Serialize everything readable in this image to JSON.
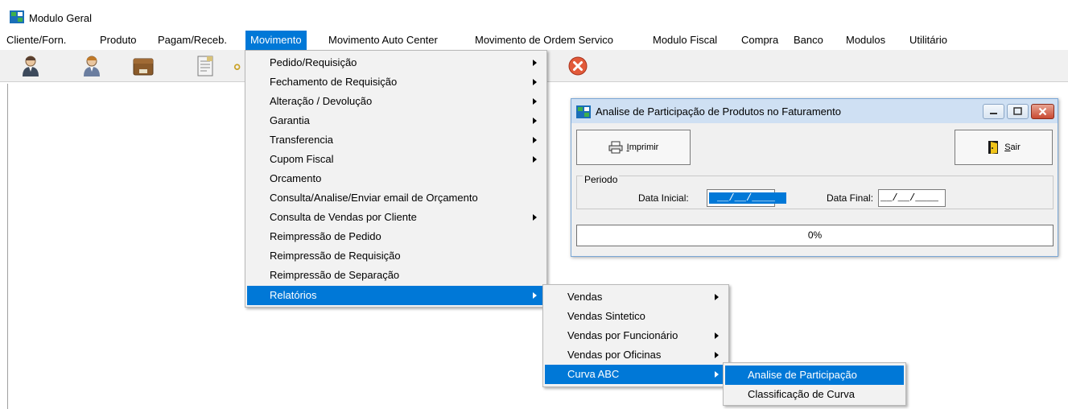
{
  "app": {
    "title": "Modulo Geral"
  },
  "menubar": {
    "items": [
      {
        "label": "Cliente/Forn.",
        "active": false
      },
      {
        "label": "Produto",
        "active": false
      },
      {
        "label": "Pagam/Receb.",
        "active": false
      },
      {
        "label": "Movimento",
        "active": true
      },
      {
        "label": "Movimento Auto Center",
        "active": false
      },
      {
        "label": "Movimento de Ordem Servico",
        "active": false
      },
      {
        "label": "Modulo Fiscal",
        "active": false
      },
      {
        "label": "Compra",
        "active": false
      },
      {
        "label": "Banco",
        "active": false
      },
      {
        "label": "Modulos",
        "active": false
      },
      {
        "label": "Utilitário",
        "active": false
      }
    ]
  },
  "toolbar": {
    "buttons": [
      "client-icon",
      "supplier-icon",
      "product-box-icon",
      "document-icon",
      "key-icon",
      "close-circle-icon"
    ]
  },
  "movimento_menu": {
    "items": [
      {
        "label": "Pedido/Requisição",
        "submenu": true
      },
      {
        "label": "Fechamento  de Requisição",
        "submenu": true
      },
      {
        "label": "Alteração / Devolução",
        "submenu": true
      },
      {
        "label": "Garantia",
        "submenu": true
      },
      {
        "label": "Transferencia",
        "submenu": true
      },
      {
        "label": "Cupom Fiscal",
        "submenu": true
      },
      {
        "label": "Orcamento",
        "submenu": false
      },
      {
        "label": "Consulta/Analise/Enviar email de Orçamento",
        "submenu": false
      },
      {
        "label": "Consulta de Vendas por Cliente",
        "submenu": true
      },
      {
        "label": "Reimpressão de Pedido",
        "submenu": false
      },
      {
        "label": "Reimpressão de Requisição",
        "submenu": false
      },
      {
        "label": "Reimpressão de Separação",
        "submenu": false
      },
      {
        "label": "Relatórios",
        "submenu": true,
        "active": true
      }
    ]
  },
  "relatorios_menu": {
    "items": [
      {
        "label": "Vendas",
        "submenu": true
      },
      {
        "label": "Vendas Sintetico",
        "submenu": false
      },
      {
        "label": "Vendas por Funcionário",
        "submenu": true
      },
      {
        "label": "Vendas por Oficinas",
        "submenu": true
      },
      {
        "label": "Curva ABC",
        "submenu": true,
        "active": true
      }
    ]
  },
  "curva_menu": {
    "items": [
      {
        "label": "Analise de Participação",
        "active": true
      },
      {
        "label": "Classificação de Curva",
        "active": false
      }
    ]
  },
  "dialog": {
    "title": "Analise de Participação de Produtos no Faturamento",
    "print_button": {
      "underlined": "I",
      "rest": "mprimir"
    },
    "exit_button": {
      "underlined": "S",
      "rest": "air"
    },
    "group_label": "Periodo",
    "start_label": "Data Inicial:",
    "start_value": "__/__/____",
    "end_label": "Data Final:",
    "end_value": "__/__/____",
    "progress_text": "0%"
  },
  "colors": {
    "accent": "#0078d7",
    "menu_bg": "#f2f2f2",
    "dialog_title_bg": "#cfe0f3"
  }
}
